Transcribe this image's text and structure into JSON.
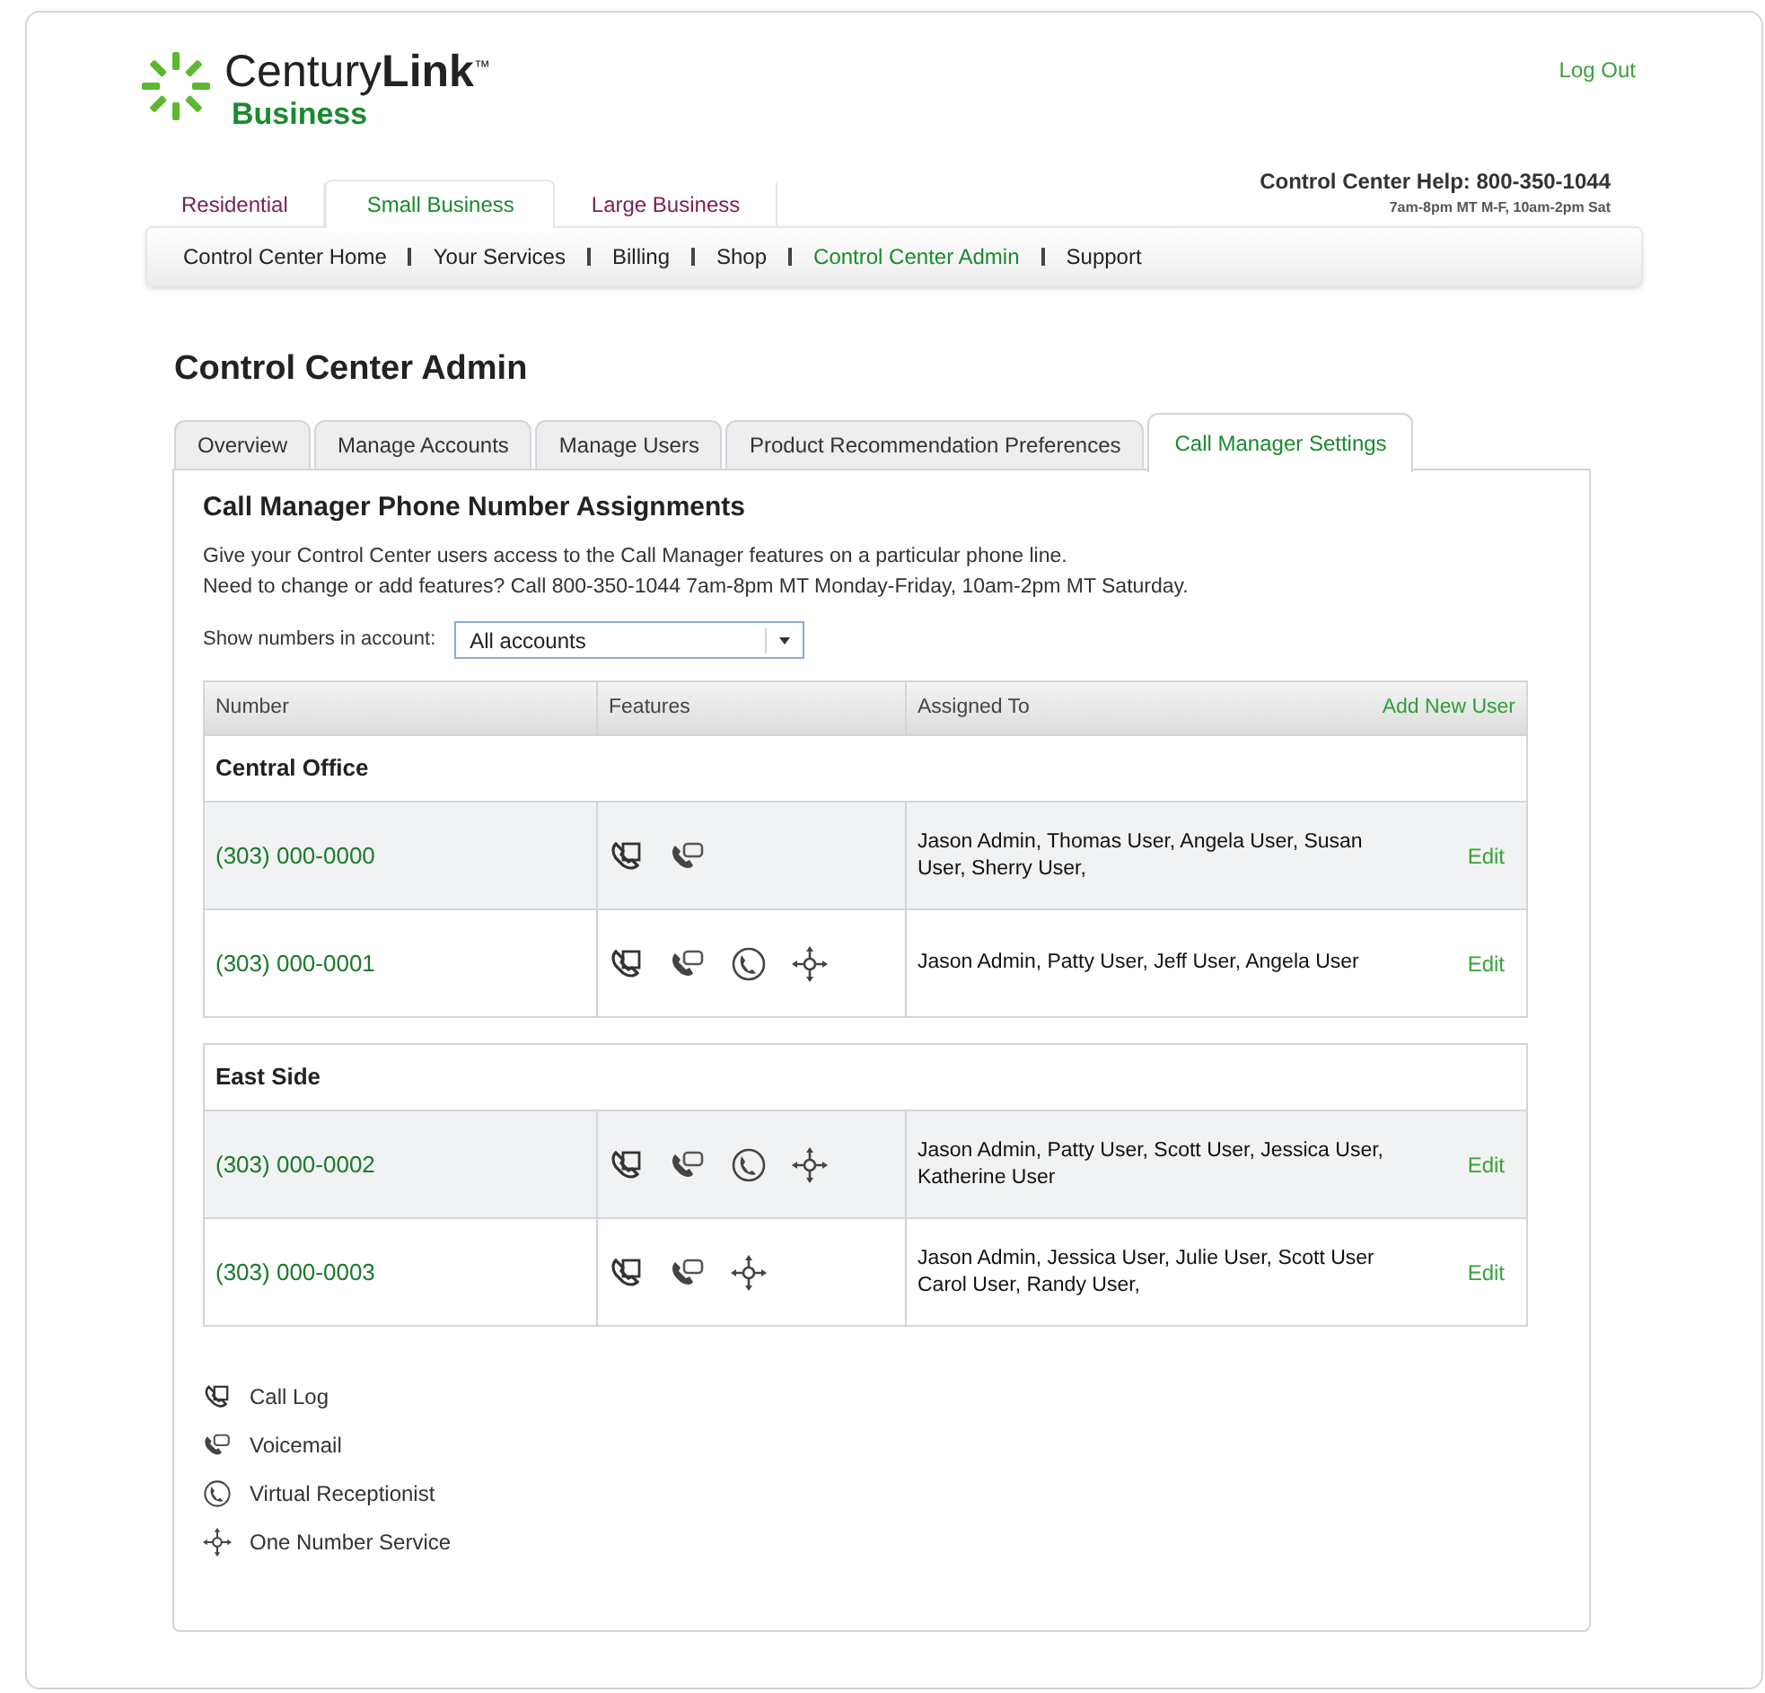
{
  "header": {
    "brand": "Century**Link**",
    "trademark": "™",
    "sub_brand": "Business",
    "logout": "Log Out",
    "help_line": "Control Center Help: 800-350-1044",
    "help_hours": "7am-8pm MT M-F, 10am-2pm Sat"
  },
  "segment_tabs": [
    {
      "label": "Residential",
      "selected": false
    },
    {
      "label": "Small Business",
      "selected": true
    },
    {
      "label": "Large Business",
      "selected": false
    }
  ],
  "nav": [
    {
      "label": "Control Center Home",
      "selected": false
    },
    {
      "label": "Your Services",
      "selected": false
    },
    {
      "label": "Billing",
      "selected": false
    },
    {
      "label": "Shop",
      "selected": false
    },
    {
      "label": "Control Center Admin",
      "selected": true
    },
    {
      "label": "Support",
      "selected": false
    }
  ],
  "page_title": "Control Center Admin",
  "tabs": [
    {
      "label": "Overview",
      "selected": false
    },
    {
      "label": "Manage Accounts",
      "selected": false
    },
    {
      "label": "Manage Users",
      "selected": false
    },
    {
      "label": "Product Recommendation Preferences",
      "selected": false
    },
    {
      "label": "Call Manager Settings",
      "selected": true
    }
  ],
  "section": {
    "title": "Call Manager Phone Number Assignments",
    "description": [
      "Give your Control Center users access to the Call Manager features on a particular phone line.",
      "Need to change or add features? Call 800-350-1044 7am-8pm MT Monday-Friday, 10am-2pm MT Saturday."
    ]
  },
  "filter": {
    "label": "Show numbers in account:",
    "value": "All accounts"
  },
  "table": {
    "columns": [
      "Number",
      "Features",
      "Assigned To"
    ],
    "add_link": "Add New User",
    "groups": [
      {
        "name": "Central Office",
        "rows": [
          {
            "number": "(303) 000-0000",
            "features": [
              {
                "kind": "call_log"
              },
              {
                "kind": "voicemail"
              }
            ],
            "assigned": "Jason Admin, Thomas User, Angela User, Susan User, Sherry User,",
            "action": "Edit"
          },
          {
            "number": "(303) 000-0001",
            "features": [
              {
                "kind": "call_log"
              },
              {
                "kind": "voicemail"
              },
              {
                "kind": "receptionist"
              },
              {
                "kind": "one_number"
              }
            ],
            "assigned": "Jason Admin, Patty User, Jeff User, Angela User",
            "action": "Edit"
          }
        ]
      },
      {
        "name": "East Side",
        "rows": [
          {
            "number": "(303) 000-0002",
            "features": [
              {
                "kind": "call_log"
              },
              {
                "kind": "voicemail"
              },
              {
                "kind": "receptionist"
              },
              {
                "kind": "one_number"
              }
            ],
            "assigned": "Jason Admin, Patty User, Scott User, Jessica User, Katherine User",
            "action": "Edit"
          },
          {
            "number": "(303) 000-0003",
            "features": [
              {
                "kind": "call_log"
              },
              {
                "kind": "voicemail"
              },
              {
                "kind": "one_number"
              }
            ],
            "assigned": "Jason Admin, Jessica User, Julie User, Scott User Carol User, Randy User,",
            "action": "Edit"
          }
        ]
      }
    ]
  },
  "legend": [
    {
      "kind": "call_log",
      "label": "Call Log"
    },
    {
      "kind": "voicemail",
      "label": "Voicemail"
    },
    {
      "kind": "receptionist",
      "label": "Virtual Receptionist"
    },
    {
      "kind": "one_number",
      "label": "One Number Service"
    }
  ]
}
